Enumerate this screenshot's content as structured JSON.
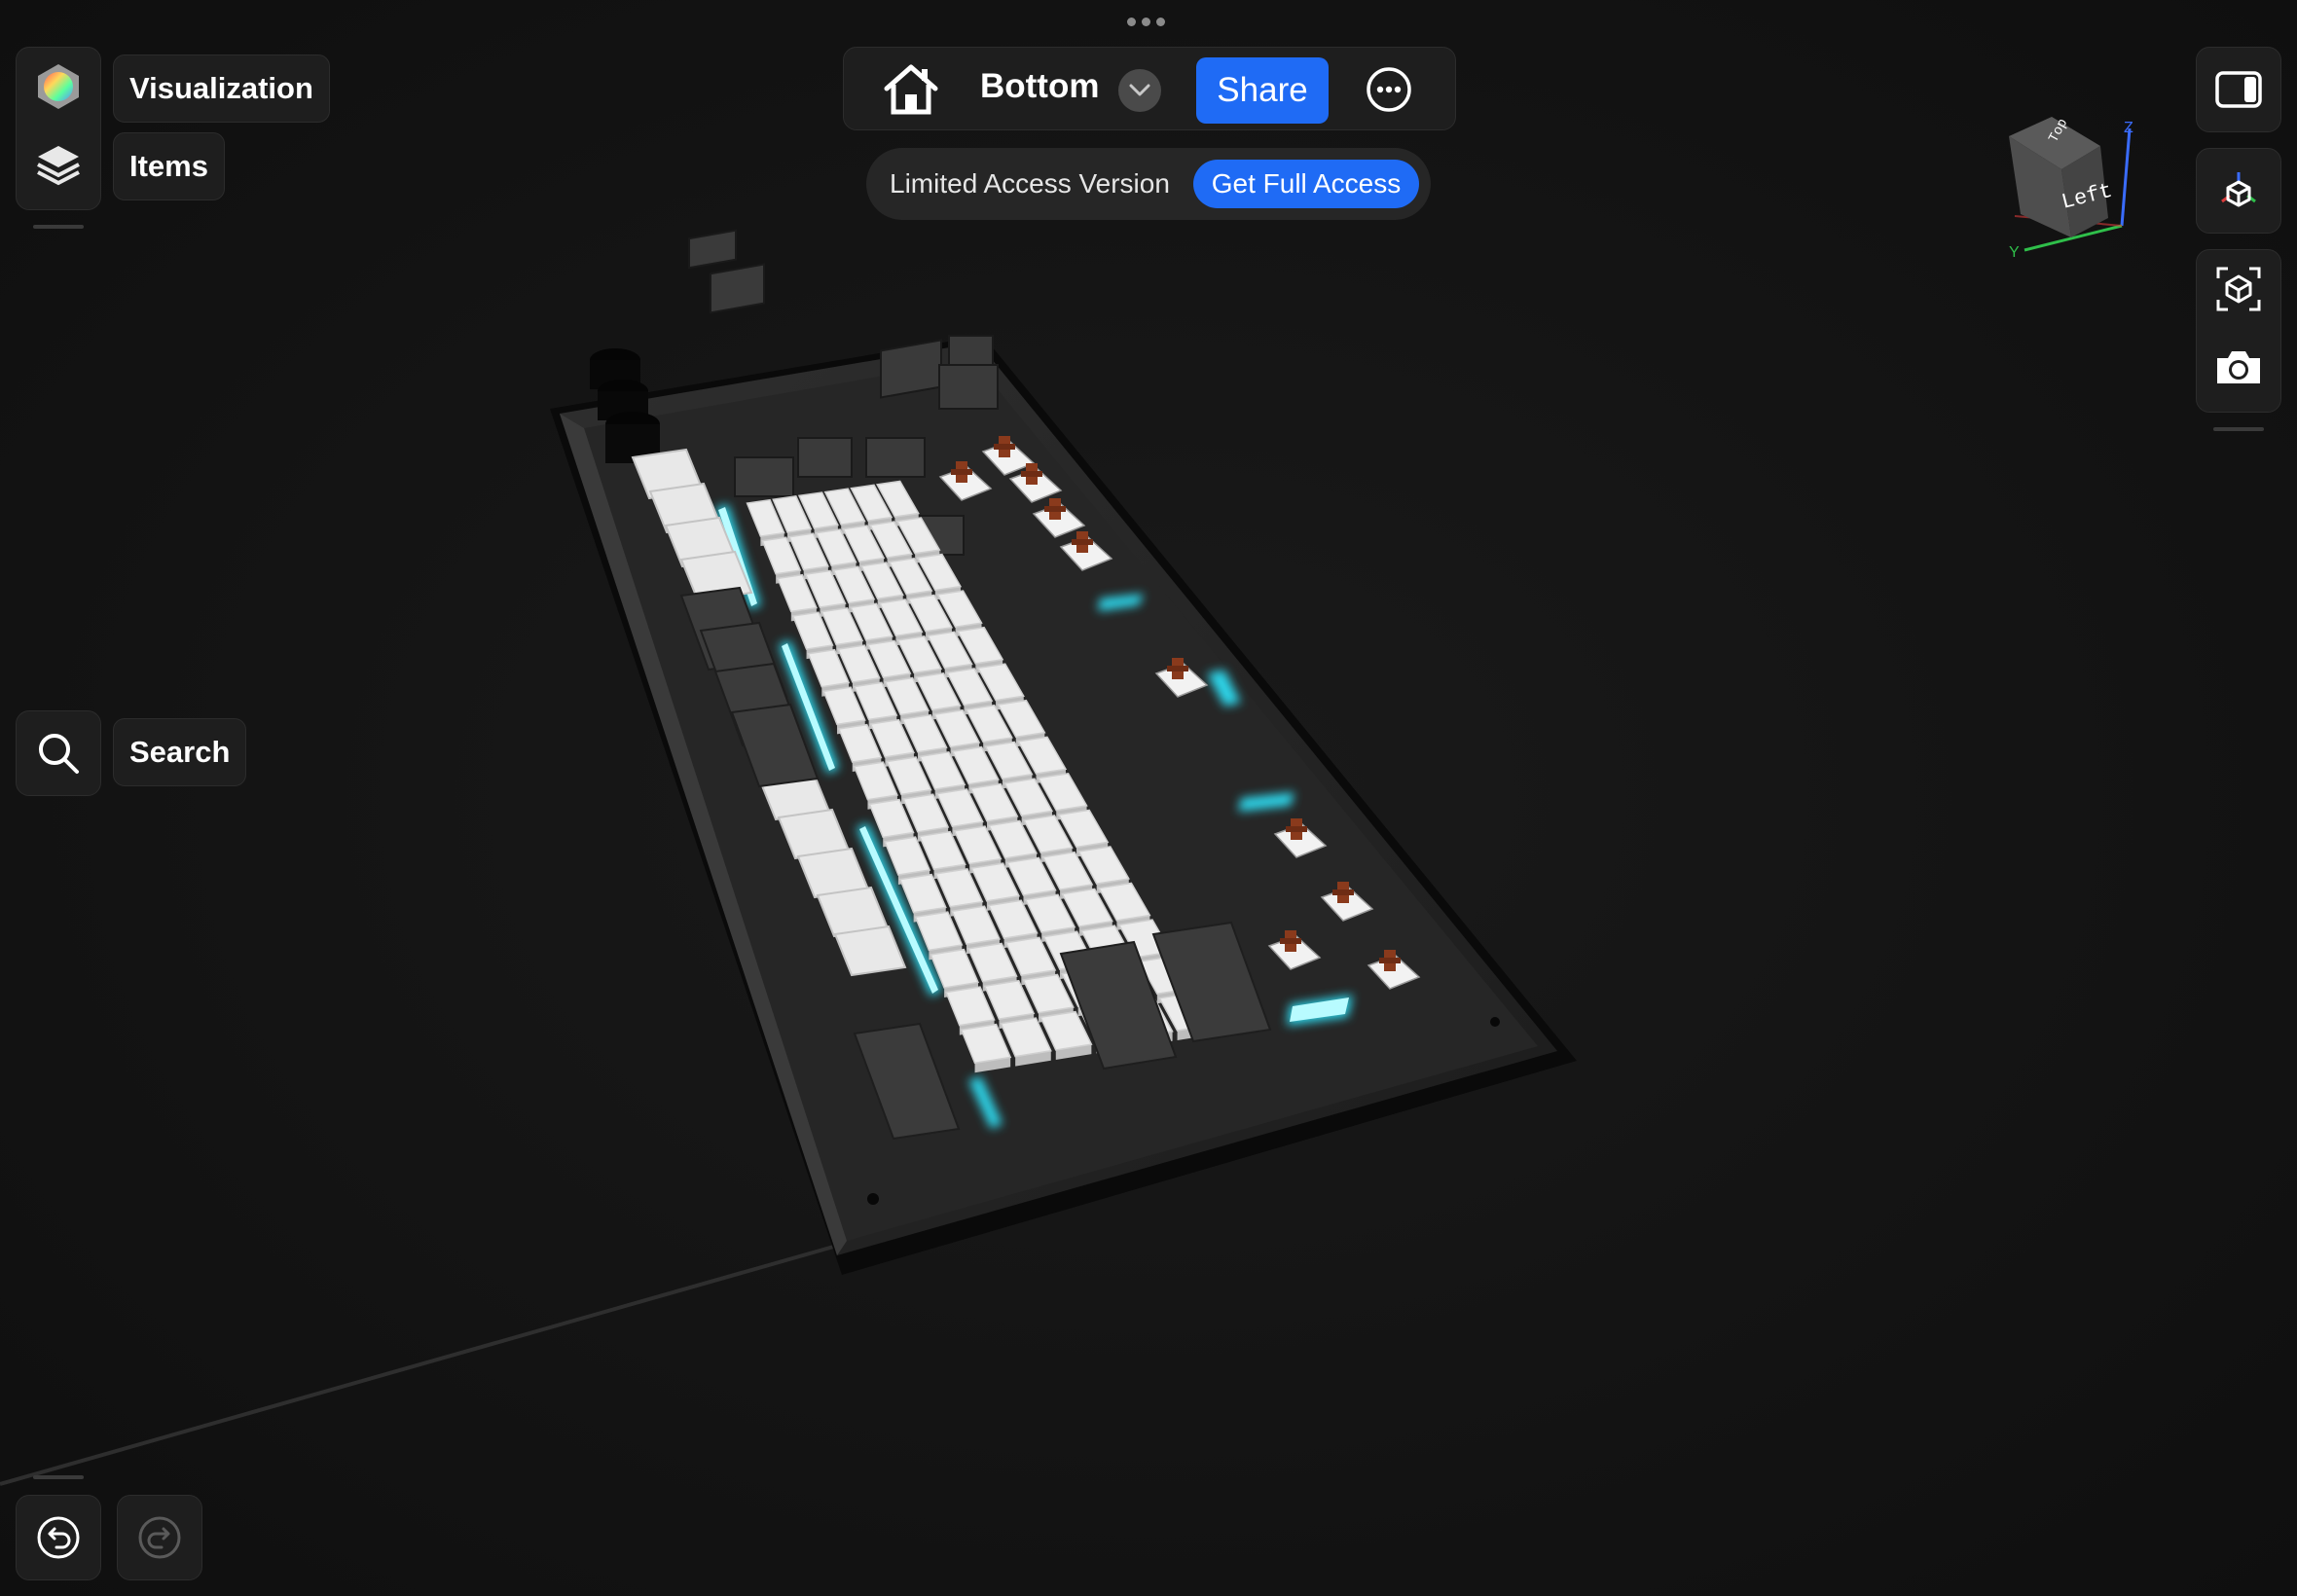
{
  "app": {
    "view_name": "Bottom",
    "share_label": "Share",
    "limited_label": "Limited Access Version",
    "full_access_label": "Get Full Access"
  },
  "left_tools": {
    "visualization_label": "Visualization",
    "items_label": "Items",
    "search_label": "Search"
  },
  "view_cube": {
    "face_front": "Left",
    "face_top": "Top",
    "axis_z": "Z",
    "axis_y": "Y"
  },
  "colors": {
    "accent": "#1f6bf5",
    "background": "#121212",
    "panel": "#1e1e1e",
    "glow": "#2fe8ff",
    "switch_stem": "#8a3a1c"
  },
  "icons": {
    "visualization": "color-wheel-cube-icon",
    "items": "layers-icon",
    "search": "search-icon",
    "home": "home-icon",
    "dropdown": "chevron-down-icon",
    "more": "ellipsis-circle-icon",
    "sidebar": "sidebar-toggle-icon",
    "axes": "axes-cube-icon",
    "ar": "ar-view-icon",
    "camera": "camera-icon",
    "undo": "undo-icon",
    "redo": "redo-icon"
  }
}
